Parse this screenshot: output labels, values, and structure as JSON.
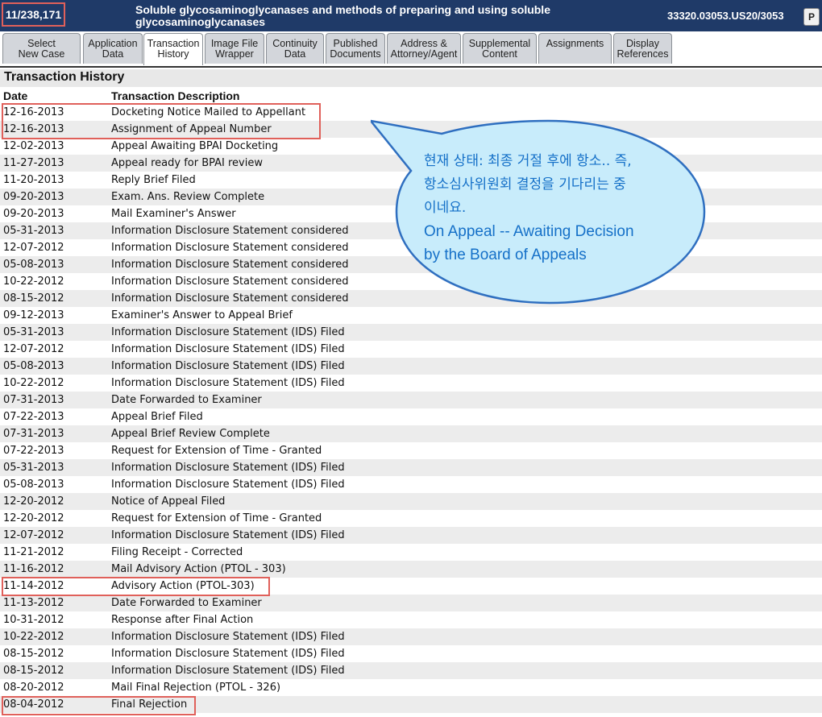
{
  "header": {
    "application_number": "11/238,171",
    "title": "Soluble glycosaminoglycanases and methods of preparing and using soluble glycosaminoglycanases",
    "docket": "33320.03053.US20/3053",
    "pdf_icon_label": "P"
  },
  "tabs": [
    {
      "label": "Select\nNew Case"
    },
    {
      "label": "Application\nData"
    },
    {
      "label": "Transaction\nHistory"
    },
    {
      "label": "Image File\nWrapper"
    },
    {
      "label": "Continuity\nData"
    },
    {
      "label": "Published\nDocuments"
    },
    {
      "label": "Address &\nAttorney/Agent"
    },
    {
      "label": "Supplemental\nContent"
    },
    {
      "label": "Assignments"
    },
    {
      "label": "Display\nReferences"
    }
  ],
  "section_title": "Transaction History",
  "table": {
    "columns": [
      "Date",
      "Transaction Description"
    ],
    "rows": [
      [
        "12-16-2013",
        "Docketing Notice Mailed to Appellant"
      ],
      [
        "12-16-2013",
        "Assignment of Appeal Number"
      ],
      [
        "12-02-2013",
        "Appeal Awaiting BPAI Docketing"
      ],
      [
        "11-27-2013",
        "Appeal ready for BPAI review"
      ],
      [
        "11-20-2013",
        "Reply Brief Filed"
      ],
      [
        "09-20-2013",
        "Exam. Ans. Review Complete"
      ],
      [
        "09-20-2013",
        "Mail Examiner's Answer"
      ],
      [
        "05-31-2013",
        "Information Disclosure Statement considered"
      ],
      [
        "12-07-2012",
        "Information Disclosure Statement considered"
      ],
      [
        "05-08-2013",
        "Information Disclosure Statement considered"
      ],
      [
        "10-22-2012",
        "Information Disclosure Statement considered"
      ],
      [
        "08-15-2012",
        "Information Disclosure Statement considered"
      ],
      [
        "09-12-2013",
        "Examiner's Answer to Appeal Brief"
      ],
      [
        "05-31-2013",
        "Information Disclosure Statement (IDS) Filed"
      ],
      [
        "12-07-2012",
        "Information Disclosure Statement (IDS) Filed"
      ],
      [
        "05-08-2013",
        "Information Disclosure Statement (IDS) Filed"
      ],
      [
        "10-22-2012",
        "Information Disclosure Statement (IDS) Filed"
      ],
      [
        "07-31-2013",
        "Date Forwarded to Examiner"
      ],
      [
        "07-22-2013",
        "Appeal Brief Filed"
      ],
      [
        "07-31-2013",
        "Appeal Brief Review Complete"
      ],
      [
        "07-22-2013",
        "Request for Extension of Time - Granted"
      ],
      [
        "05-31-2013",
        "Information Disclosure Statement (IDS) Filed"
      ],
      [
        "05-08-2013",
        "Information Disclosure Statement (IDS) Filed"
      ],
      [
        "12-20-2012",
        "Notice of Appeal Filed"
      ],
      [
        "12-20-2012",
        "Request for Extension of Time - Granted"
      ],
      [
        "12-07-2012",
        "Information Disclosure Statement (IDS) Filed"
      ],
      [
        "11-21-2012",
        "Filing Receipt - Corrected"
      ],
      [
        "11-16-2012",
        "Mail Advisory Action (PTOL - 303)"
      ],
      [
        "11-14-2012",
        "Advisory Action (PTOL-303)"
      ],
      [
        "11-13-2012",
        "Date Forwarded to Examiner"
      ],
      [
        "10-31-2012",
        "Response after Final Action"
      ],
      [
        "10-22-2012",
        "Information Disclosure Statement (IDS) Filed"
      ],
      [
        "08-15-2012",
        "Information Disclosure Statement (IDS) Filed"
      ],
      [
        "08-15-2012",
        "Information Disclosure Statement (IDS) Filed"
      ],
      [
        "08-20-2012",
        "Mail Final Rejection (PTOL - 326)"
      ],
      [
        "08-04-2012",
        "Final Rejection"
      ]
    ]
  },
  "annotation": {
    "korean": "현재 상태: 최종 거절 후에 항소.. 즉,\n항소심사위원회 결정을 기다리는 중\n이네요.",
    "english": "On Appeal -- Awaiting Decision\nby the Board of Appeals",
    "text_color": "#1570c8",
    "bubble_fill": "#c8ecfb",
    "highlight_color": "#e0605a"
  }
}
